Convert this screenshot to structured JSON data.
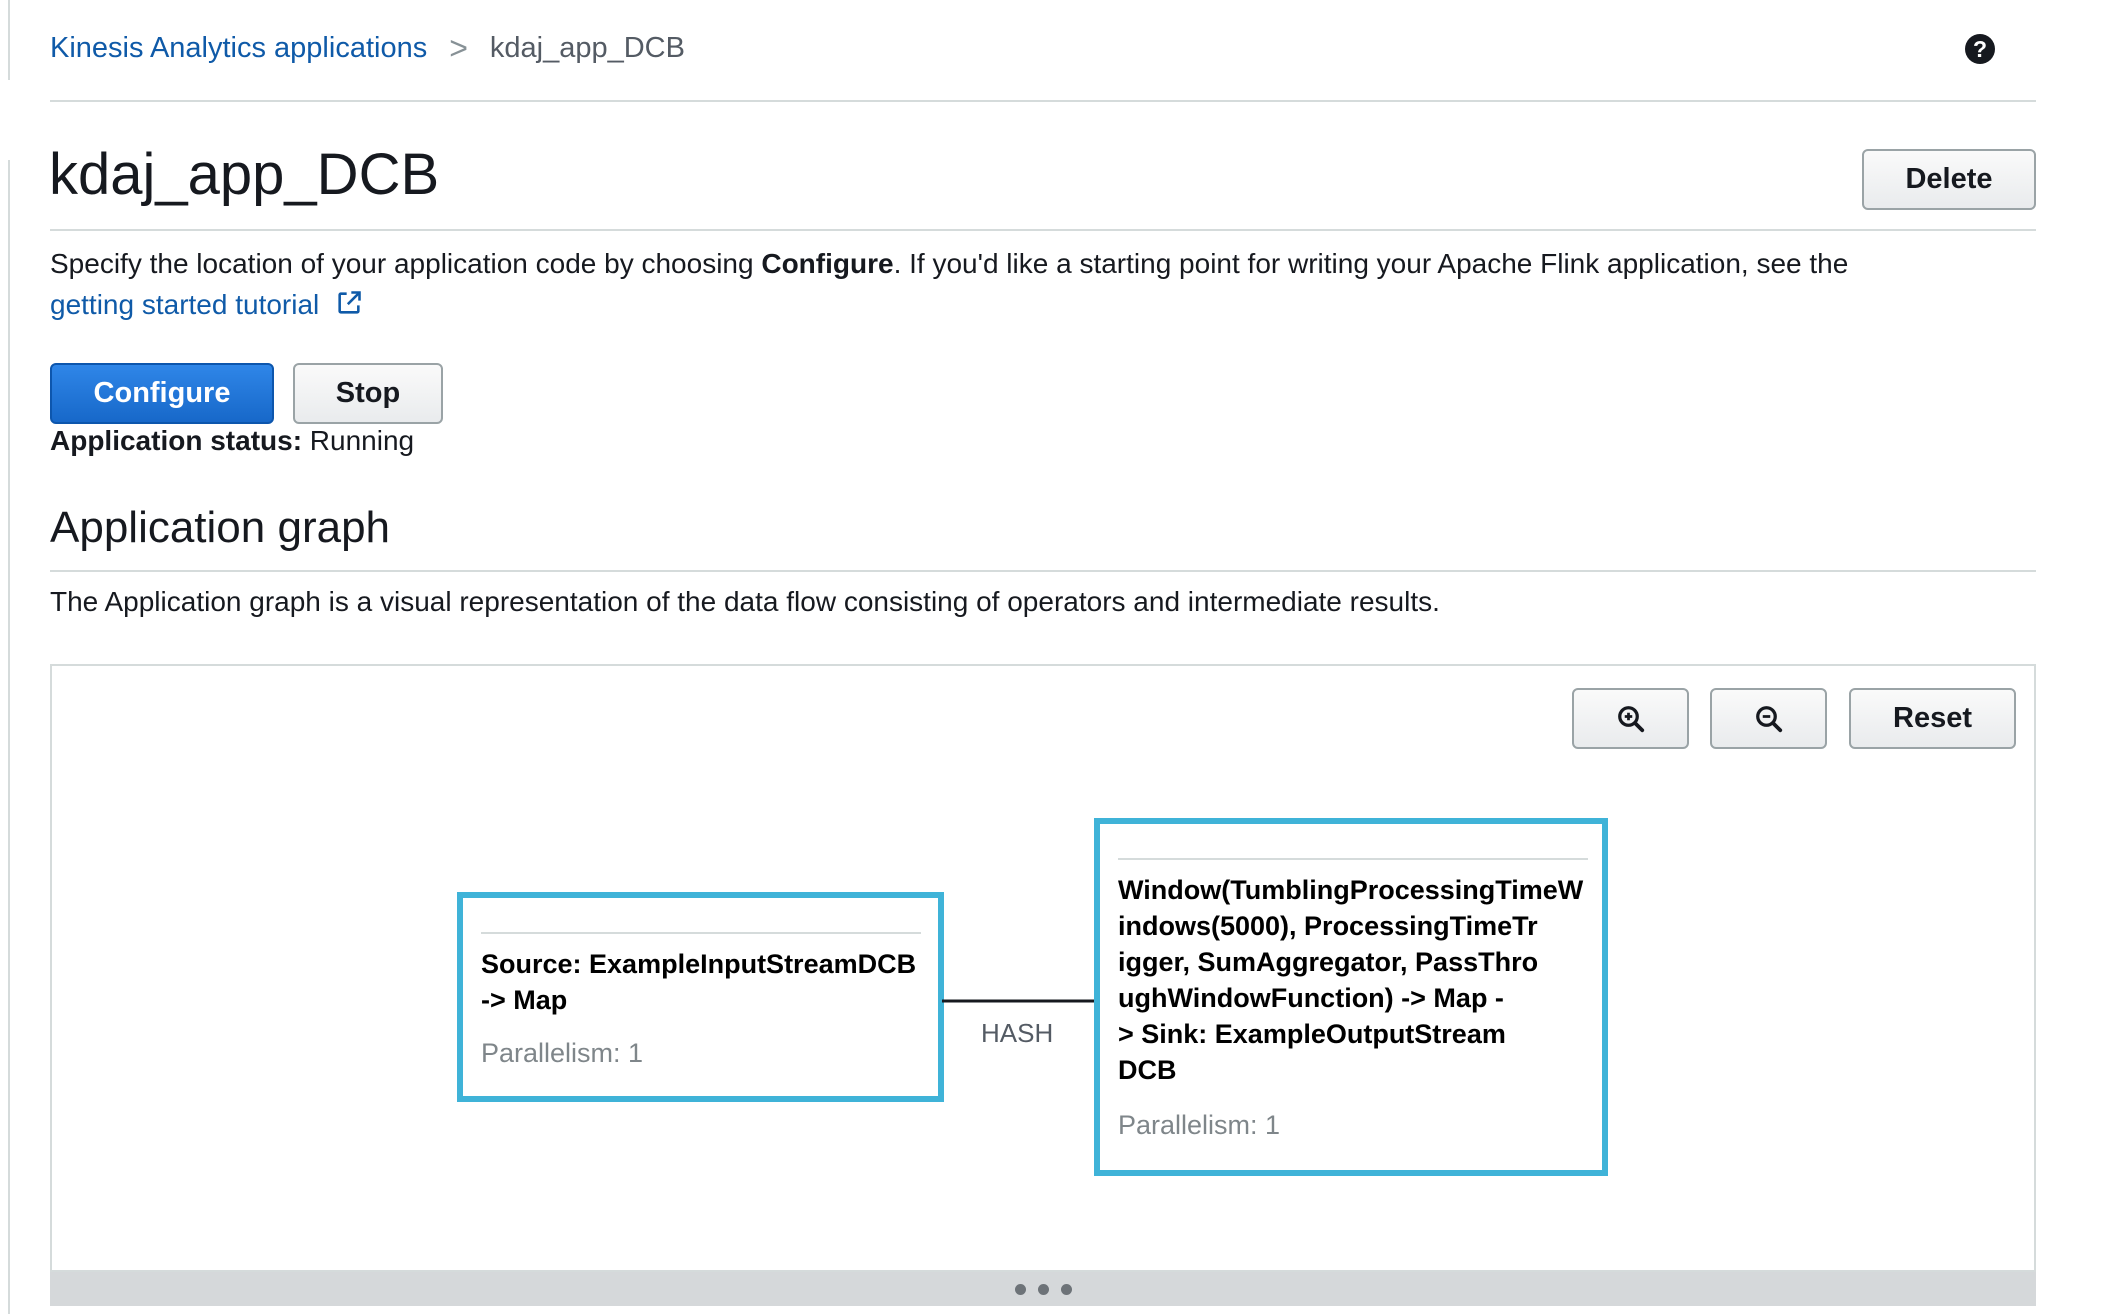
{
  "breadcrumb": {
    "parent": "Kinesis Analytics applications",
    "separator": ">",
    "current": "kdaj_app_DCB"
  },
  "help_icon": "?",
  "page": {
    "title": "kdaj_app_DCB",
    "delete_label": "Delete"
  },
  "description": {
    "text_before": "Specify the location of your application code by choosing ",
    "bold_word": "Configure",
    "text_after": ". If you'd like a starting point for writing your Apache Flink application, see the",
    "link_text": "getting started tutorial"
  },
  "actions": {
    "configure_label": "Configure",
    "stop_label": "Stop"
  },
  "status": {
    "label": "Application status:",
    "value": "Running"
  },
  "graph_section": {
    "title": "Application graph",
    "description": "The Application graph is a visual representation of the data flow consisting of operators and intermediate results.",
    "zoom_in_icon": "zoom-in-icon",
    "zoom_out_icon": "zoom-out-icon",
    "reset_label": "Reset",
    "nodes": [
      {
        "name_lines": [
          "Source: ExampleInputStreamDCB",
          "-> Map"
        ],
        "parallelism": "Parallelism: 1"
      },
      {
        "name_lines": [
          "Window(TumblingProcessingTimeW",
          "indows(5000), ProcessingTimeTr",
          "igger, SumAggregator, PassThro",
          "ughWindowFunction) -> Map -",
          "> Sink: ExampleOutputStream",
          "DCB"
        ],
        "parallelism": "Parallelism: 1"
      }
    ],
    "edge_label": "HASH",
    "border_color": "#3fb3d8"
  },
  "colors": {
    "primary_button": "#1768c9",
    "link": "#0f5aa8"
  }
}
